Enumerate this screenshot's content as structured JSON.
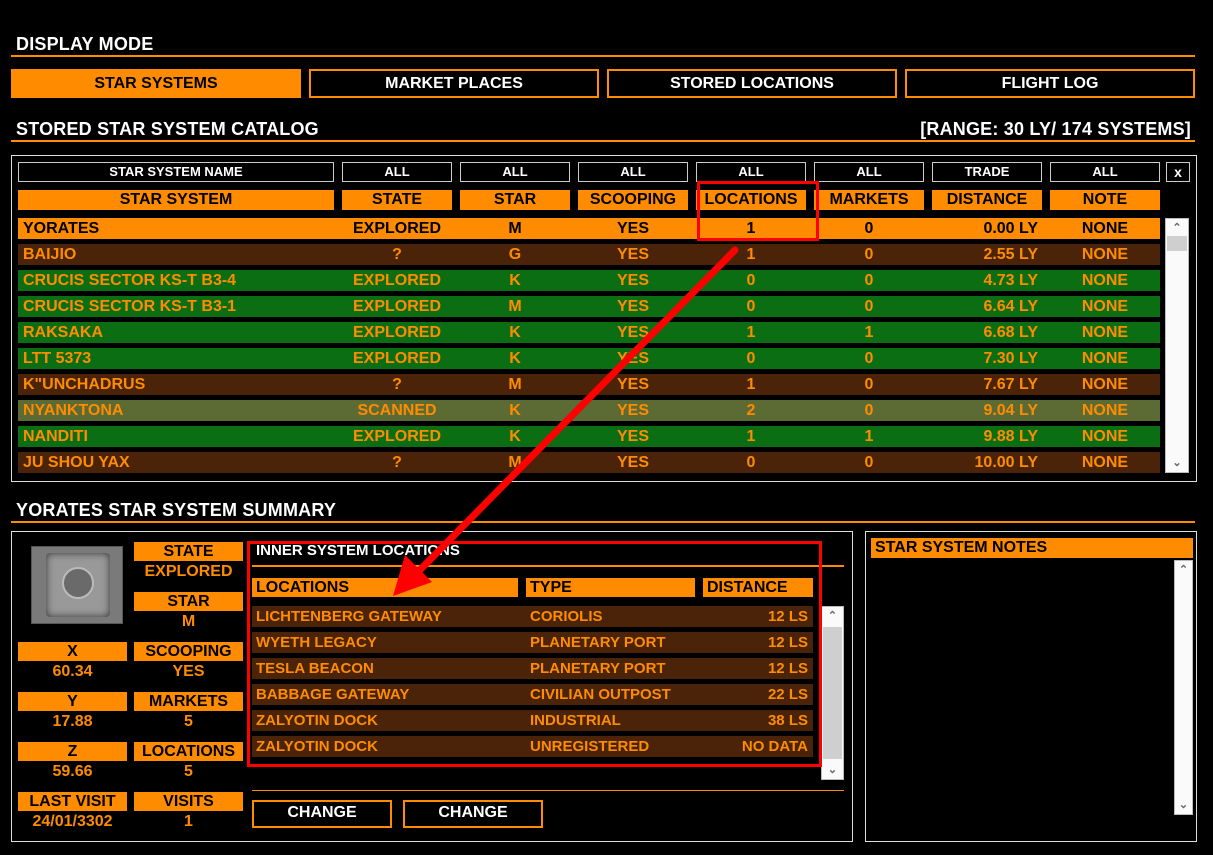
{
  "display_mode": {
    "title": "DISPLAY MODE",
    "buttons": [
      "STAR SYSTEMS",
      "MARKET PLACES",
      "STORED LOCATIONS",
      "FLIGHT LOG"
    ]
  },
  "catalog": {
    "title": "STORED STAR SYSTEM CATALOG",
    "range": "[RANGE: 30 LY/ 174 SYSTEMS]",
    "filters": [
      "STAR SYSTEM NAME",
      "ALL",
      "ALL",
      "ALL",
      "ALL",
      "ALL",
      "TRADE",
      "ALL"
    ],
    "clear_label": "x",
    "columns": [
      "STAR SYSTEM",
      "STATE",
      "STAR",
      "SCOOPING",
      "LOCATIONS",
      "MARKETS",
      "DISTANCE",
      "NOTE"
    ],
    "rows": [
      {
        "name": "YORATES",
        "state": "EXPLORED",
        "star": "M",
        "scoop": "YES",
        "loc": "1",
        "mkt": "0",
        "dist": "0.00 LY",
        "note": "NONE"
      },
      {
        "name": "BAIJIO",
        "state": "?",
        "star": "G",
        "scoop": "YES",
        "loc": "1",
        "mkt": "0",
        "dist": "2.55 LY",
        "note": "NONE"
      },
      {
        "name": "CRUCIS SECTOR KS-T B3-4",
        "state": "EXPLORED",
        "star": "K",
        "scoop": "YES",
        "loc": "0",
        "mkt": "0",
        "dist": "4.73 LY",
        "note": "NONE"
      },
      {
        "name": "CRUCIS SECTOR KS-T B3-1",
        "state": "EXPLORED",
        "star": "M",
        "scoop": "YES",
        "loc": "0",
        "mkt": "0",
        "dist": "6.64 LY",
        "note": "NONE"
      },
      {
        "name": "RAKSAKA",
        "state": "EXPLORED",
        "star": "K",
        "scoop": "YES",
        "loc": "1",
        "mkt": "1",
        "dist": "6.68 LY",
        "note": "NONE"
      },
      {
        "name": "LTT 5373",
        "state": "EXPLORED",
        "star": "K",
        "scoop": "YES",
        "loc": "0",
        "mkt": "0",
        "dist": "7.30 LY",
        "note": "NONE"
      },
      {
        "name": "K\"UNCHADRUS",
        "state": "?",
        "star": "M",
        "scoop": "YES",
        "loc": "1",
        "mkt": "0",
        "dist": "7.67 LY",
        "note": "NONE"
      },
      {
        "name": "NYANKTONA",
        "state": "SCANNED",
        "star": "K",
        "scoop": "YES",
        "loc": "2",
        "mkt": "0",
        "dist": "9.04 LY",
        "note": "NONE"
      },
      {
        "name": "NANDITI",
        "state": "EXPLORED",
        "star": "K",
        "scoop": "YES",
        "loc": "1",
        "mkt": "1",
        "dist": "9.88 LY",
        "note": "NONE"
      },
      {
        "name": "JU SHOU YAX",
        "state": "?",
        "star": "M",
        "scoop": "YES",
        "loc": "0",
        "mkt": "0",
        "dist": "10.00 LY",
        "note": "NONE"
      }
    ]
  },
  "summary": {
    "title": "YORATES STAR SYSTEM SUMMARY",
    "state_label": "STATE",
    "state": "EXPLORED",
    "star_label": "STAR",
    "star": "M",
    "x_label": "X",
    "x": "60.34",
    "scoop_label": "SCOOPING",
    "scoop": "YES",
    "y_label": "Y",
    "y": "17.88",
    "markets_label": "MARKETS",
    "markets": "5",
    "z_label": "Z",
    "z": "59.66",
    "locations_label": "LOCATIONS",
    "locations": "5",
    "last_visit_label": "LAST VISIT",
    "last_visit": "24/01/3302",
    "visits_label": "VISITS",
    "visits": "1",
    "inner_title": "INNER SYSTEM LOCATIONS",
    "loc_columns": [
      "LOCATIONS",
      "TYPE",
      "DISTANCE"
    ],
    "locations_list": [
      {
        "name": "LICHTENBERG GATEWAY",
        "type": "CORIOLIS",
        "dist": "12 LS"
      },
      {
        "name": "WYETH LEGACY",
        "type": "PLANETARY PORT",
        "dist": "12 LS"
      },
      {
        "name": "TESLA BEACON",
        "type": "PLANETARY PORT",
        "dist": "12 LS"
      },
      {
        "name": "BABBAGE GATEWAY",
        "type": "CIVILIAN OUTPOST",
        "dist": "22 LS"
      },
      {
        "name": "ZALYOTIN DOCK",
        "type": "INDUSTRIAL",
        "dist": "38 LS"
      },
      {
        "name": "ZALYOTIN DOCK",
        "type": "UNREGISTERED",
        "dist": "NO DATA"
      }
    ],
    "change_buttons": [
      "CHANGE",
      "CHANGE"
    ],
    "notes_title": "STAR SYSTEM NOTES"
  },
  "colors": {
    "accent": "#ff8c00",
    "highlight": "#ff0000",
    "green_row": "#0b6e12",
    "brown_row": "#4a2308",
    "olive_row": "#5b6b33"
  }
}
